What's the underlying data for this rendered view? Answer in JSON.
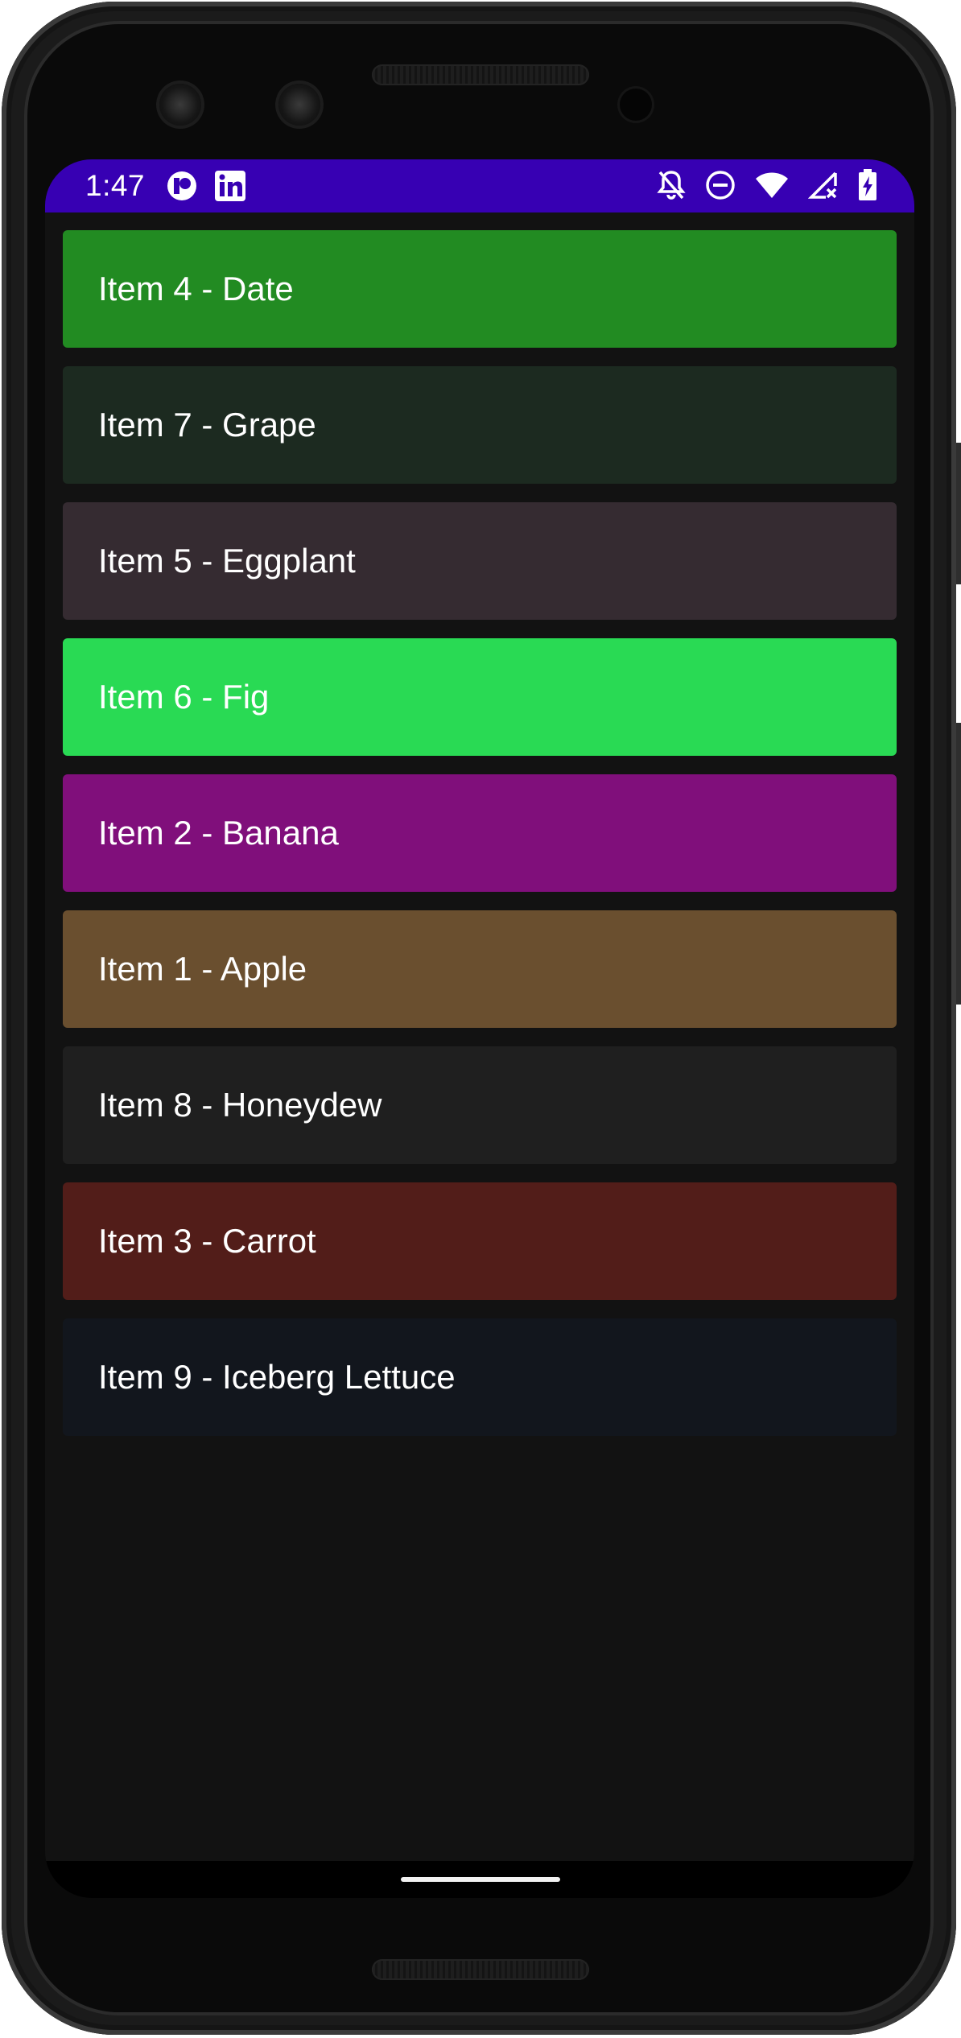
{
  "status_bar": {
    "time": "1:47",
    "background": "#3700b3",
    "left_icons": [
      "app-notification-icon",
      "linkedin-icon"
    ],
    "right_icons": [
      "notifications-off-icon",
      "do-not-disturb-icon",
      "wifi-icon",
      "no-signal-icon",
      "battery-charging-icon"
    ]
  },
  "list": {
    "items": [
      {
        "label": "Item 4 - Date",
        "color": "#228b22"
      },
      {
        "label": "Item 7 - Grape",
        "color": "#1c2a20"
      },
      {
        "label": "Item 5 - Eggplant",
        "color": "#352b31"
      },
      {
        "label": "Item 6 - Fig",
        "color": "#29da54"
      },
      {
        "label": "Item 2 - Banana",
        "color": "#800f7b"
      },
      {
        "label": "Item 1 - Apple",
        "color": "#6a4f2f"
      },
      {
        "label": "Item 8 - Honeydew",
        "color": "#1f1f1f"
      },
      {
        "label": "Item 3 - Carrot",
        "color": "#521d19"
      },
      {
        "label": "Item 9 - Iceberg Lettuce",
        "color": "#12161d"
      }
    ]
  }
}
